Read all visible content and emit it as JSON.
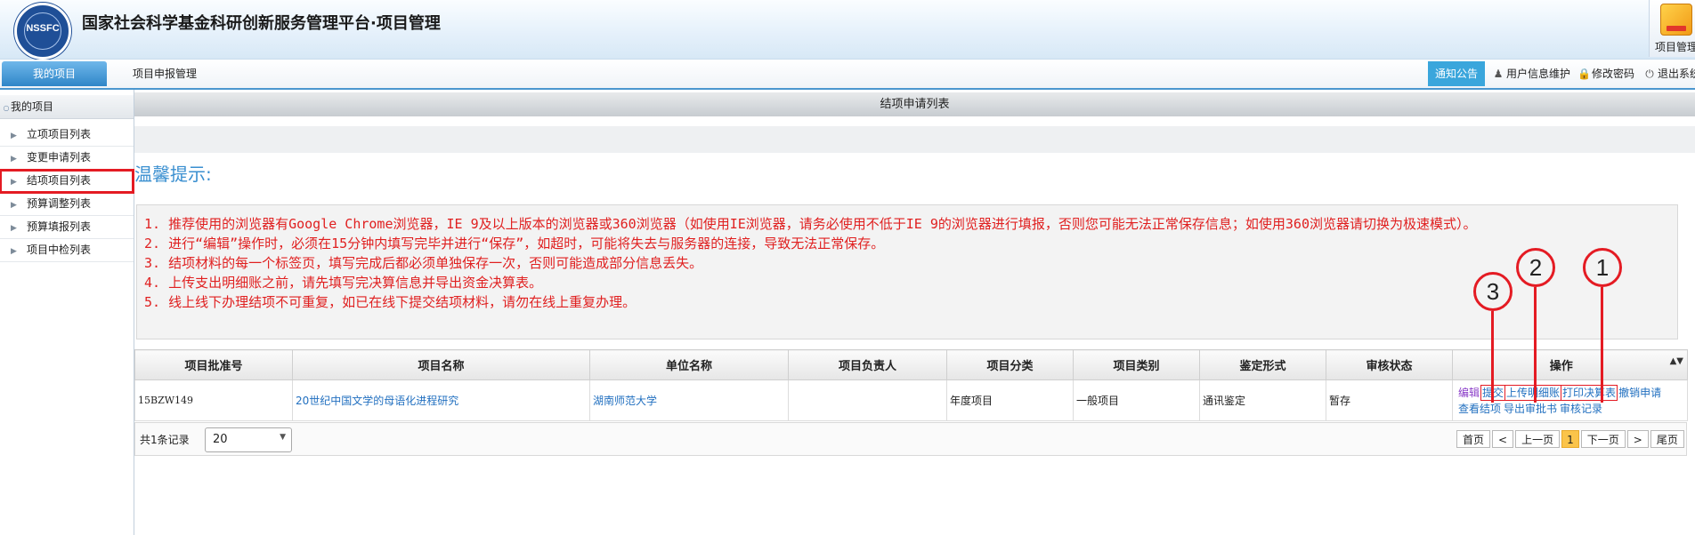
{
  "header": {
    "logo_text": "NSSFC",
    "platform_title": "国家社会科学基金科研创新服务管理平台·项目管理",
    "project_mgmt_label": "项目管理"
  },
  "nav": {
    "tabs": [
      "我的项目",
      "项目申报管理"
    ],
    "notice": "通知公告",
    "user_info": "用户信息维护",
    "change_password": "修改密码",
    "logout": "退出系统"
  },
  "sidebar": {
    "heading": "我的项目",
    "items": [
      "立项项目列表",
      "变更申请列表",
      "结项项目列表",
      "预算调整列表",
      "预算填报列表",
      "项目中检列表"
    ],
    "active_index": 2
  },
  "main": {
    "list_title": "结项申请列表",
    "tips_title": "温馨提示:",
    "tips": [
      "1. 推荐使用的浏览器有Google Chrome浏览器，IE 9及以上版本的浏览器或360浏览器（如使用IE浏览器，请务必使用不低于IE 9的浏览器进行填报，否则您可能无法正常保存信息；如使用360浏览器请切换为极速模式）。",
      "2. 进行“编辑”操作时，必须在15分钟内填写完毕并进行“保存”，如超时，可能将失去与服务器的连接，导致无法正常保存。",
      "3. 结项材料的每一个标签页，填写完成后都必须单独保存一次，否则可能造成部分信息丢失。",
      "4. 上传支出明细账之前，请先填写完决算信息并导出资金决算表。",
      "5. 线上线下办理结项不可重复，如已在线下提交结项材料，请勿在线上重复办理。"
    ]
  },
  "table": {
    "columns": [
      "项目批准号",
      "项目名称",
      "单位名称",
      "项目负责人",
      "项目分类",
      "项目类别",
      "鉴定形式",
      "审核状态",
      "操作"
    ],
    "rows": [
      {
        "approval_no": "15BZW149",
        "name": "20世纪中国文学的母语化进程研究",
        "unit": "湖南师范大学",
        "leader": "",
        "category": "年度项目",
        "type": "一般项目",
        "appraisal": "通讯鉴定",
        "status": "暂存",
        "ops": [
          "编辑",
          "提交",
          "上传明细账",
          "打印决算表",
          "撤销申请",
          "查看结项",
          "导出审批书",
          "审核记录"
        ]
      }
    ]
  },
  "footer": {
    "count_text": "共1条记录",
    "page_size": "20",
    "pager": [
      "首页",
      "<",
      "上一页",
      "1",
      "下一页",
      ">",
      "尾页"
    ]
  },
  "annotations": [
    "1",
    "2",
    "3"
  ]
}
